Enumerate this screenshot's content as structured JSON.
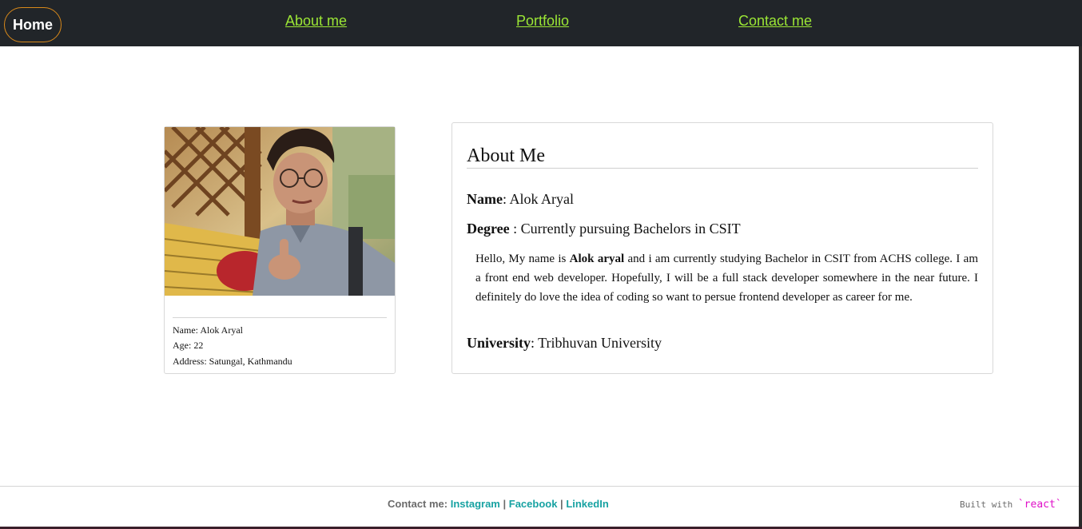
{
  "nav": {
    "home_label": "Home",
    "links": [
      "About me",
      "Portfolio",
      "Contact me"
    ]
  },
  "profile": {
    "photo_icon": "profile-photo",
    "name_line": "Name: Alok Aryal",
    "age_line": "Age: 22",
    "address_line": "Address: Satungal, Kathmandu"
  },
  "about": {
    "title": "About Me",
    "name_label": "Name",
    "name_value": ": Alok Aryal",
    "degree_label": "Degree",
    "degree_value": " : Currently pursuing Bachelors in CSIT",
    "bio_prefix": "Hello, My name is ",
    "bio_bold": "Alok aryal",
    "bio_suffix": " and i am currently studying Bachelor in CSIT from ACHS college. I am a front end web developer. Hopefully, I will be a full stack developer somewhere in the near future. I definitely do love the idea of coding so want to persue frontend developer as career for me.",
    "university_label": "University",
    "university_value": ": Tribhuvan University"
  },
  "footer": {
    "contact_prefix": "Contact me: ",
    "links": [
      "Instagram",
      "Facebook",
      "LinkedIn"
    ],
    "separator": " | ",
    "built_with": "Built with ",
    "react_label": "`react`"
  },
  "colors": {
    "navbar_bg": "#212529",
    "nav_link": "#9be635",
    "home_border": "#d9891a",
    "footer_link": "#17a2a2",
    "react_accent": "#e010c8"
  }
}
